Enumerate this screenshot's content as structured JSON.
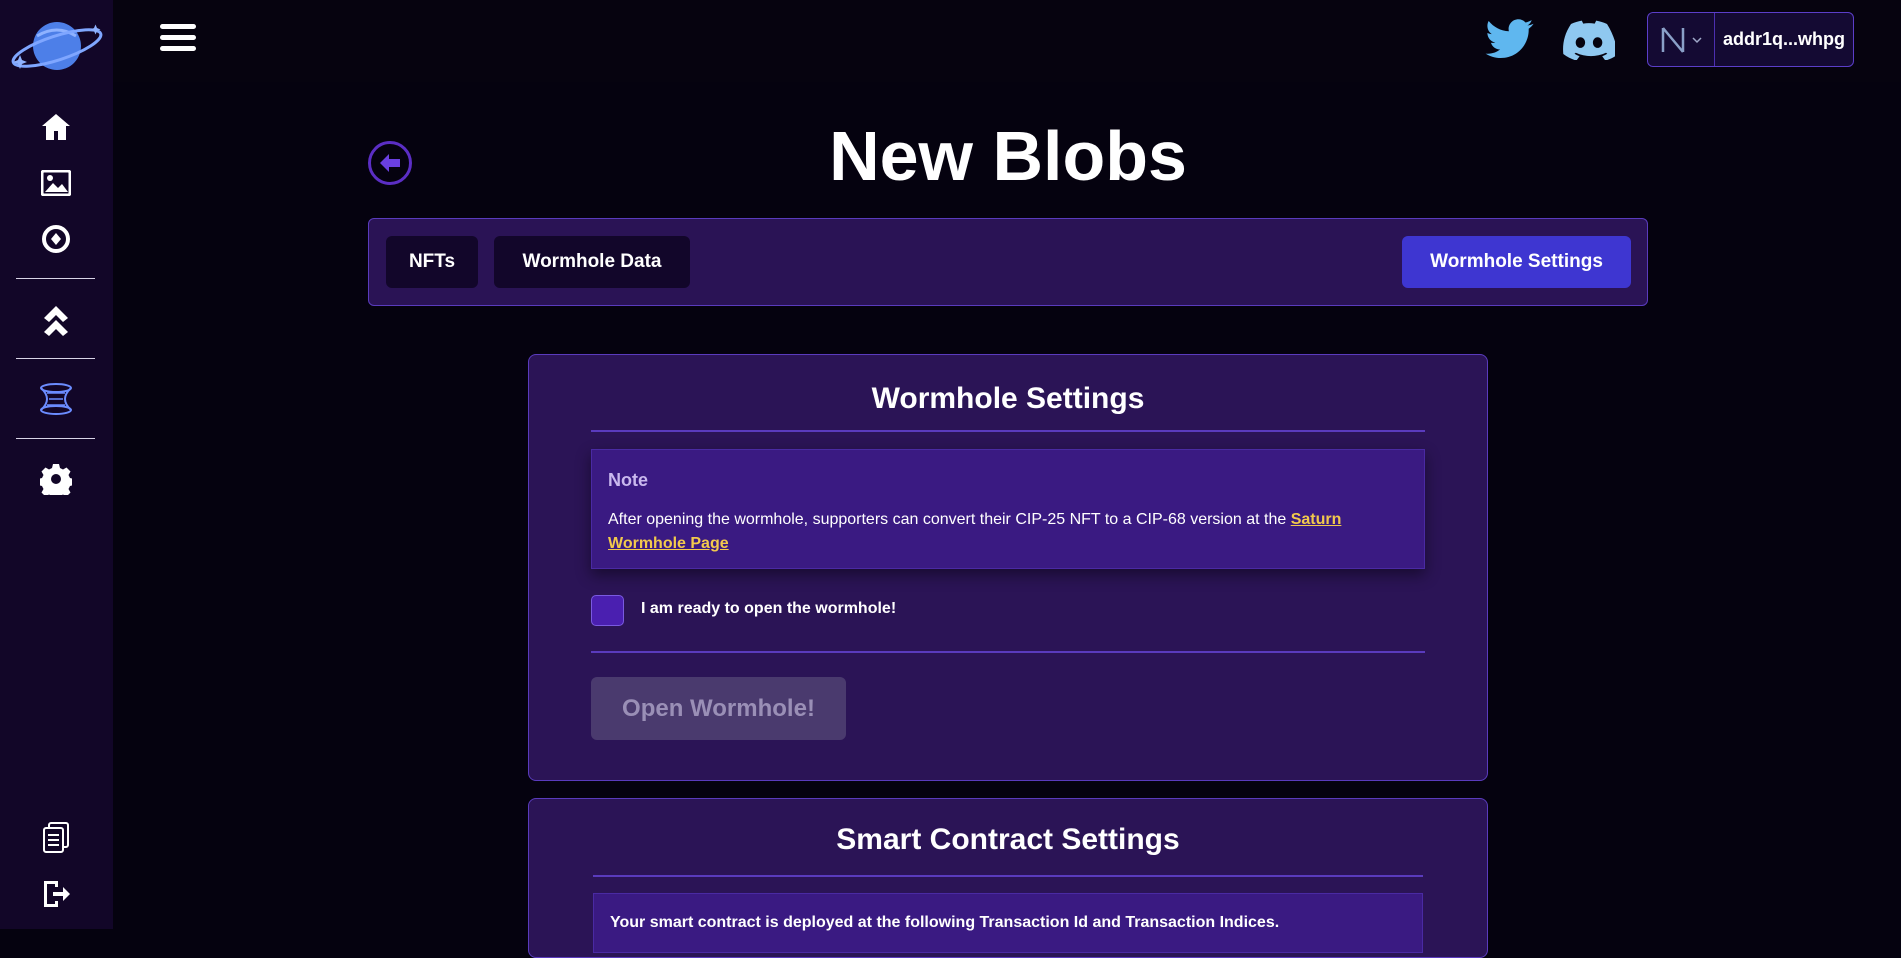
{
  "topbar": {
    "wallet_address": "addr1q...whpg"
  },
  "page": {
    "title": "New Blobs"
  },
  "tabs": [
    {
      "label": "NFTs",
      "active": false
    },
    {
      "label": "Wormhole Data",
      "active": false
    },
    {
      "label": "Wormhole Settings",
      "active": true
    }
  ],
  "wormhole_card": {
    "title": "Wormhole Settings",
    "note_title": "Note",
    "note_text": "After opening the wormhole, supporters can convert their CIP-25 NFT to a CIP-68 version at the",
    "note_link": "Saturn Wormhole Page",
    "checkbox_label": "I am ready to open the wormhole!",
    "checkbox_checked": false,
    "button_label": "Open Wormhole!"
  },
  "contract_card": {
    "title": "Smart Contract Settings",
    "note_text": "Your smart contract is deployed at the following Transaction Id and Transaction Indices."
  },
  "colors": {
    "accent": "#3e36d1",
    "link": "#f2c94c",
    "card_bg": "#2b1456",
    "sidebar_bg": "#120628"
  }
}
